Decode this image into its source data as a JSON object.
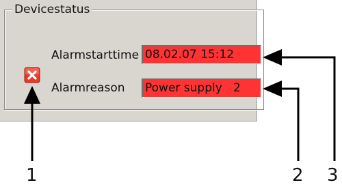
{
  "groupbox": {
    "title": "Devicestatus"
  },
  "fields": [
    {
      "label": "Alarmstarttime",
      "value": "08.02.07 15:12"
    },
    {
      "label": "Alarmreason",
      "value": "Power supply   2"
    }
  ],
  "status_icon": {
    "name": "alarm-error-icon",
    "color": "#e8392a"
  },
  "callouts": [
    "1",
    "2",
    "3"
  ],
  "colors": {
    "panel_background": "#d9d6d0",
    "alarm_field_background": "#ff3333"
  }
}
